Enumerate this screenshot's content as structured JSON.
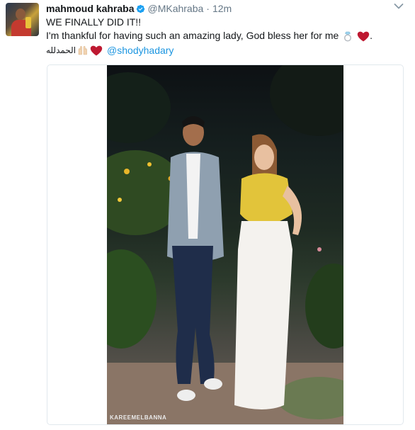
{
  "tweet": {
    "author": {
      "name": "mahmoud kahraba",
      "handle": "@MKahraba",
      "verified": true
    },
    "separator": "·",
    "timestamp": "12m",
    "text": {
      "line1": "WE FINALLY DID IT!!",
      "line2": "I'm thankful for having such an amazing lady, God bless her for me",
      "line2_end": ".",
      "arabic": "الحمدلله",
      "mention": "@shodyhadary"
    },
    "emojis": [
      "ring-icon",
      "red-heart-icon",
      "raised-hands-icon",
      "red-heart-icon"
    ],
    "photo": {
      "watermark": "KAREEMELBANNA"
    }
  },
  "colors": {
    "text": "#14171a",
    "secondary": "#657786",
    "link": "#1b95e0",
    "verified": "#1da1f2",
    "heart": "#be1931",
    "border": "#e1e8ed"
  }
}
